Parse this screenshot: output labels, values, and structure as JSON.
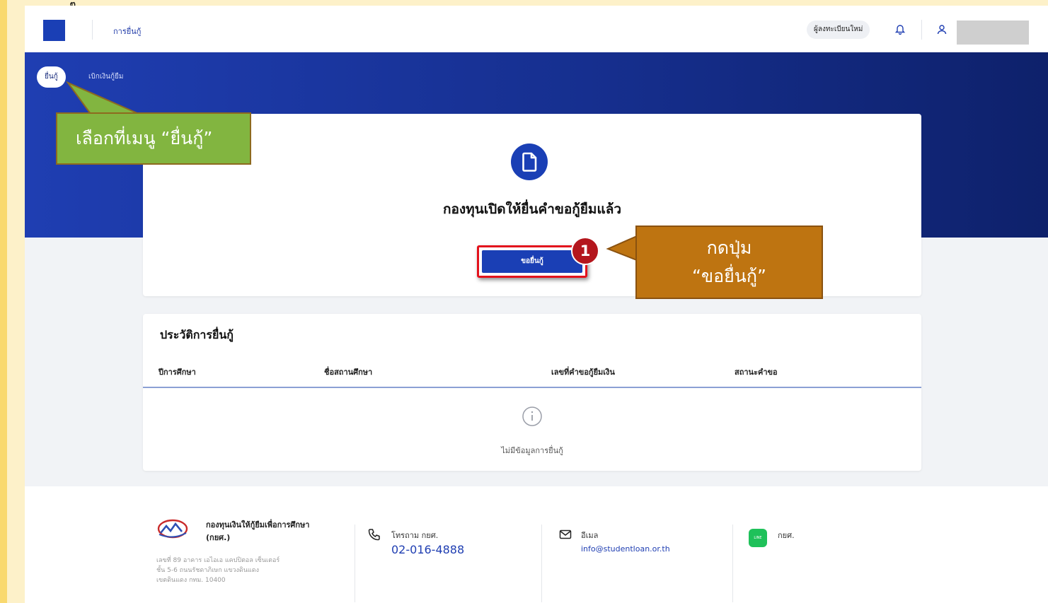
{
  "header": {
    "nav_active": "การยื่นกู้",
    "register_label": "ผู้ลงทะเบียนใหม่",
    "username": ""
  },
  "hero": {
    "tab_active": "ยื่นกู้",
    "tab_other": "เบิกเงินกู้ยืม"
  },
  "apply_card": {
    "title": "กองทุนเปิดให้ยื่นคำขอกู้ยืมแล้ว",
    "button_label": "ขอยื่นกู้",
    "step_badge": "1"
  },
  "history": {
    "title": "ประวัติการยื่นกู้",
    "columns": [
      "ปีการศึกษา",
      "ชื่อสถานศึกษา",
      "เลขที่คำขอกู้ยืมเงิน",
      "สถานะคำขอ"
    ],
    "empty_message": "ไม่มีข้อมูลการยื่นกู้"
  },
  "footer": {
    "fund_name": "กองทุนเงินให้กู้ยืมเพื่อการศึกษา (กยศ.)",
    "address_lines": [
      "เลขที่ 89 อาคาร เอไอเอ แคปปิตอล เซ็นเตอร์",
      "ชั้น 5-6 ถนนรัชดาภิเษก แขวงดินแดง",
      "เขตดินแดง กทม. 10400"
    ],
    "phone_label": "โทรถาม กยศ.",
    "phone_number": "02-016-4888",
    "email_label": "อีเมล",
    "email_value": "info@studentloan.or.th",
    "line_label": "กยศ.",
    "line_icon_text": "LINE"
  },
  "callouts": {
    "menu_hint": "เลือกที่เมนู “ยื่นกู้”",
    "button_hint_line1": "กดปุ่ม",
    "button_hint_line2": "“ขอยื่นกู้”"
  },
  "frame": {
    "top_glyph": "ๆ"
  },
  "colors": {
    "primary": "#1a3fb5",
    "hero_gradient_start": "#1f3eb2",
    "hero_gradient_end": "#0e216b",
    "highlight_red": "#e3121c",
    "badge_red": "#b4161d",
    "callout_green": "#82b540",
    "callout_brown": "#be7411",
    "frame_yellow": "#f9d96f"
  },
  "icons": {
    "bell": "bell-icon",
    "user": "user-icon",
    "document": "document-icon",
    "info": "info-icon",
    "phone": "phone-icon",
    "mail": "mail-icon",
    "line": "line-icon"
  }
}
